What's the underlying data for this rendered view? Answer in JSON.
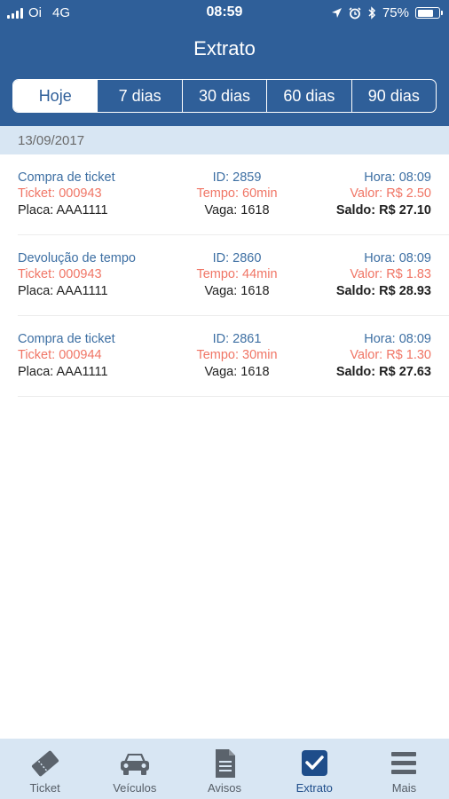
{
  "status": {
    "carrier": "Oi",
    "network": "4G",
    "time": "08:59",
    "battery": "75%",
    "battery_level": 0.75
  },
  "header": {
    "title": "Extrato"
  },
  "segments": [
    {
      "label": "Hoje",
      "active": true
    },
    {
      "label": "7 dias",
      "active": false
    },
    {
      "label": "30 dias",
      "active": false
    },
    {
      "label": "60 dias",
      "active": false
    },
    {
      "label": "90 dias",
      "active": false
    }
  ],
  "date": "13/09/2017",
  "transactions": [
    {
      "type": "Compra de ticket",
      "id": "ID: 2859",
      "hora": "Hora: 08:09",
      "ticket": "Ticket: 000943",
      "tempo": "Tempo: 60min",
      "valor": "Valor: R$ 2.50",
      "placa": "Placa: AAA1111",
      "vaga": "Vaga: 1618",
      "saldo": "Saldo: R$ 27.10"
    },
    {
      "type": "Devolução de tempo",
      "id": "ID: 2860",
      "hora": "Hora: 08:09",
      "ticket": "Ticket: 000943",
      "tempo": "Tempo: 44min",
      "valor": "Valor: R$ 1.83",
      "placa": "Placa: AAA1111",
      "vaga": "Vaga: 1618",
      "saldo": "Saldo: R$ 28.93"
    },
    {
      "type": "Compra de ticket",
      "id": "ID: 2861",
      "hora": "Hora: 08:09",
      "ticket": "Ticket: 000944",
      "tempo": "Tempo: 30min",
      "valor": "Valor: R$ 1.30",
      "placa": "Placa: AAA1111",
      "vaga": "Vaga: 1618",
      "saldo": "Saldo: R$ 27.63"
    }
  ],
  "tabbar": [
    {
      "label": "Ticket",
      "icon": "ticket-icon",
      "active": false
    },
    {
      "label": "Veículos",
      "icon": "car-icon",
      "active": false
    },
    {
      "label": "Avisos",
      "icon": "document-icon",
      "active": false
    },
    {
      "label": "Extrato",
      "icon": "checkbox-icon",
      "active": true
    },
    {
      "label": "Mais",
      "icon": "menu-icon",
      "active": false
    }
  ],
  "colors": {
    "header": "#2f5f99",
    "accent_blue": "#3d6fa3",
    "accent_red": "#f07565",
    "tabbar_bg": "#d8e6f3"
  }
}
